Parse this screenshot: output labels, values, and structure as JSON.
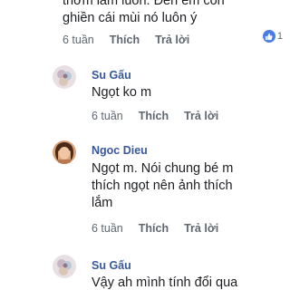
{
  "top_comment": {
    "line1": "thơm lắm luôn. Đến em còn",
    "line2": "ghiền cái mùi nó luôn ý",
    "time": "6 tuần",
    "like_label": "Thích",
    "reply_label": "Trả lời",
    "reaction_count": "1"
  },
  "comments": [
    {
      "name": "Su Gấu",
      "lines": [
        "Ngọt ko m"
      ],
      "time": "6 tuần",
      "like_label": "Thích",
      "reply_label": "Trả lời"
    },
    {
      "name": "Ngoc Dieu",
      "lines": [
        "Ngọt m. Nói chung bé m",
        "thích ngọt nên ảnh thích",
        "lắm"
      ],
      "time": "6 tuần",
      "like_label": "Thích",
      "reply_label": "Trả lời"
    },
    {
      "name": "Su Gấu",
      "lines": [
        "Vậy ah mình tính đổi qua"
      ]
    }
  ],
  "colors": {
    "name": "#385898",
    "meta": "#606770",
    "text": "#1c1e21",
    "reaction": "#4a7de2"
  }
}
